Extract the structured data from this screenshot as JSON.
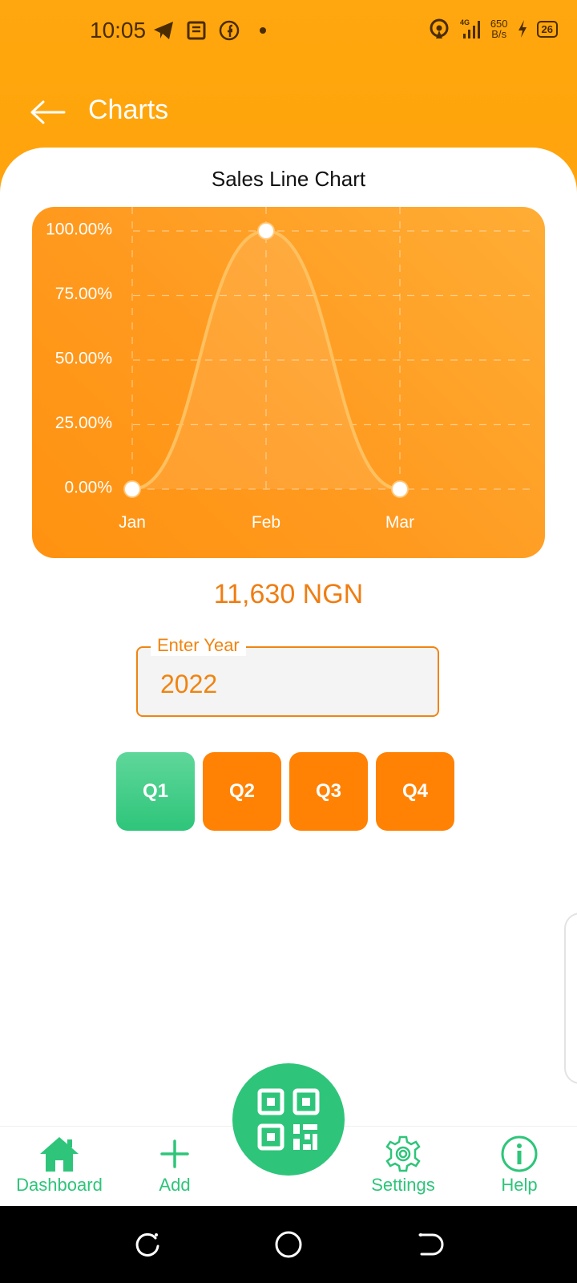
{
  "status_bar": {
    "time": "10:05",
    "net_speed_value": "650",
    "net_speed_unit": "B/s",
    "signal_type": "4G",
    "battery": "26",
    "icons_left": [
      "telegram-icon",
      "news-icon",
      "facebook-icon",
      "dot-icon"
    ],
    "icons_right": [
      "hotspot-icon",
      "signal-icon",
      "charging-icon",
      "battery-icon"
    ]
  },
  "header": {
    "title": "Charts",
    "back_icon": "arrow-left-icon"
  },
  "chart": {
    "heading": "Sales Line Chart"
  },
  "chart_data": {
    "type": "line",
    "title": "Sales Line Chart",
    "categories": [
      "Jan",
      "Feb",
      "Mar"
    ],
    "values": [
      0,
      100,
      0
    ],
    "y_ticks": [
      "100.00%",
      "75.00%",
      "50.00%",
      "25.00%",
      "0.00%"
    ],
    "ylim": [
      0,
      100
    ],
    "grid": true,
    "xlabel": "",
    "ylabel": "",
    "colors": {
      "background": "#ff9a1f",
      "line": "#ffc160",
      "point": "#ffffff"
    }
  },
  "summary": {
    "total": "11,630 NGN"
  },
  "year_input": {
    "label": "Enter Year",
    "value": "2022"
  },
  "quarters": {
    "items": [
      "Q1",
      "Q2",
      "Q3",
      "Q4"
    ],
    "selected": "Q1"
  },
  "bottom_nav": {
    "items": [
      {
        "label": "Dashboard",
        "icon": "home-icon"
      },
      {
        "label": "Add",
        "icon": "plus-icon"
      },
      {
        "label": "Settings",
        "icon": "gear-icon"
      },
      {
        "label": "Help",
        "icon": "info-icon"
      }
    ],
    "fab_icon": "qr-code-icon"
  },
  "colors": {
    "accent": "#ffa30b",
    "orange_button": "#ff8205",
    "green": "#2ec57a",
    "amount_text": "#f07d12"
  }
}
